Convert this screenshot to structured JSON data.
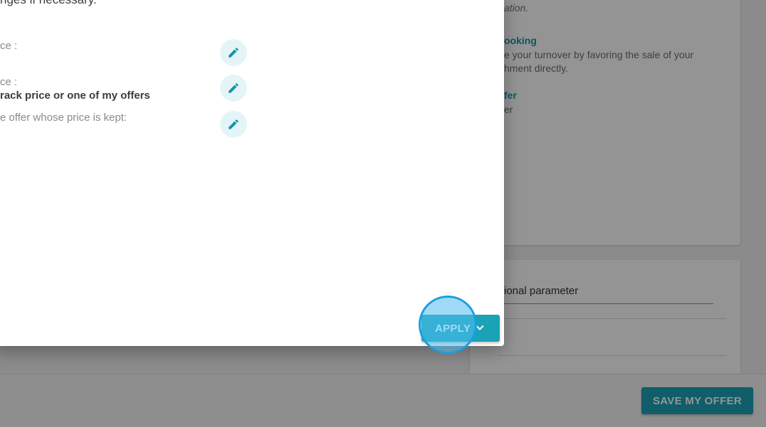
{
  "background": {
    "italic_text": "ation.",
    "booking_title": "ooking",
    "booking_desc_line1": "e your turnover by favoring the sale of your",
    "booking_desc_line2": "hment directly.",
    "offer_title": "fer",
    "offer_desc": "er",
    "optional_field_value": "ional parameter",
    "save_label": "SAVE MY OFFER"
  },
  "dialog": {
    "intro": "nges if necessary.",
    "rows": [
      {
        "label": "ce :",
        "value": ""
      },
      {
        "label": "ce :",
        "value": "rack price or one of my offers"
      },
      {
        "label": "e offer whose price is kept:",
        "value": ""
      }
    ],
    "apply_label": "APPLY"
  },
  "colors": {
    "accent": "#1aa2b7",
    "link": "#1593a8",
    "click_indicator": "#1a9fe0"
  }
}
